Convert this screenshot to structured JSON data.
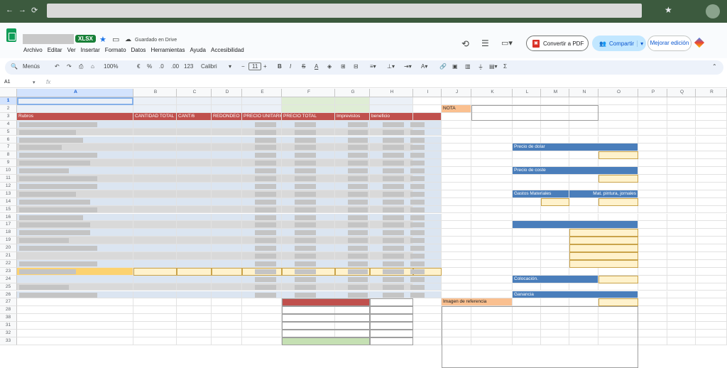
{
  "browser": {
    "back": "←",
    "forward": "→",
    "reload": "C",
    "star": "★",
    "more": "⋮"
  },
  "app": {
    "file_badge": "XLSX",
    "saved_status": "Guardado en Drive",
    "menu": [
      "Archivo",
      "Editar",
      "Ver",
      "Insertar",
      "Formato",
      "Datos",
      "Herramientas",
      "Ayuda",
      "Accesibilidad"
    ],
    "pdf_button": "Convertir a PDF",
    "share_button": "Compartir",
    "improve_button": "Mejorar edición"
  },
  "toolbar": {
    "menus": "Menús",
    "zoom": "100%",
    "currency": "€",
    "percent": "%",
    "dec_less": ".0",
    "dec_more": ".00",
    "format_123": "123",
    "font": "Calibri",
    "font_size": "11",
    "bold": "B",
    "italic": "I",
    "strike": "S",
    "text_color": "A",
    "sigma": "Σ"
  },
  "formula": {
    "cell_ref": "A1",
    "fx": "fx"
  },
  "sheet": {
    "columns": [
      "A",
      "B",
      "C",
      "D",
      "E",
      "F",
      "G",
      "H",
      "I",
      "J",
      "K",
      "L",
      "M",
      "N",
      "O",
      "P",
      "Q",
      "R"
    ],
    "rows": [
      "1",
      "2",
      "3",
      "4",
      "5",
      "6",
      "7",
      "8",
      "9",
      "10",
      "11",
      "12",
      "13",
      "14",
      "15",
      "16",
      "17",
      "18",
      "19",
      "20",
      "21",
      "22",
      "23",
      "24",
      "25",
      "26",
      "27",
      "28",
      "38",
      "31",
      "32",
      "33"
    ],
    "headers": {
      "rubros": "Rubros",
      "cantidad_total": "CANTIDAD TOTAL",
      "cant6": "CANT/6",
      "redondeo": "REDONDEO",
      "precio_unitario": "PRECIO UNITARIO",
      "precio_total": "PRECIO TOTAL",
      "imprevistos": "Imprevistos",
      "beneficio": "beneficio"
    },
    "nota": "NOTA",
    "imagen_referencia": "Imagen de referencia",
    "side_blocks": {
      "precio_dolar": "Precio de dolar",
      "precio_coste": "Precio de coste",
      "gastos_materiales": "Gastos Materiales",
      "mat_pintura": "Mat. pintura, jornales",
      "colocacion": "Colocación.",
      "ganancia": "Ganancia"
    }
  }
}
